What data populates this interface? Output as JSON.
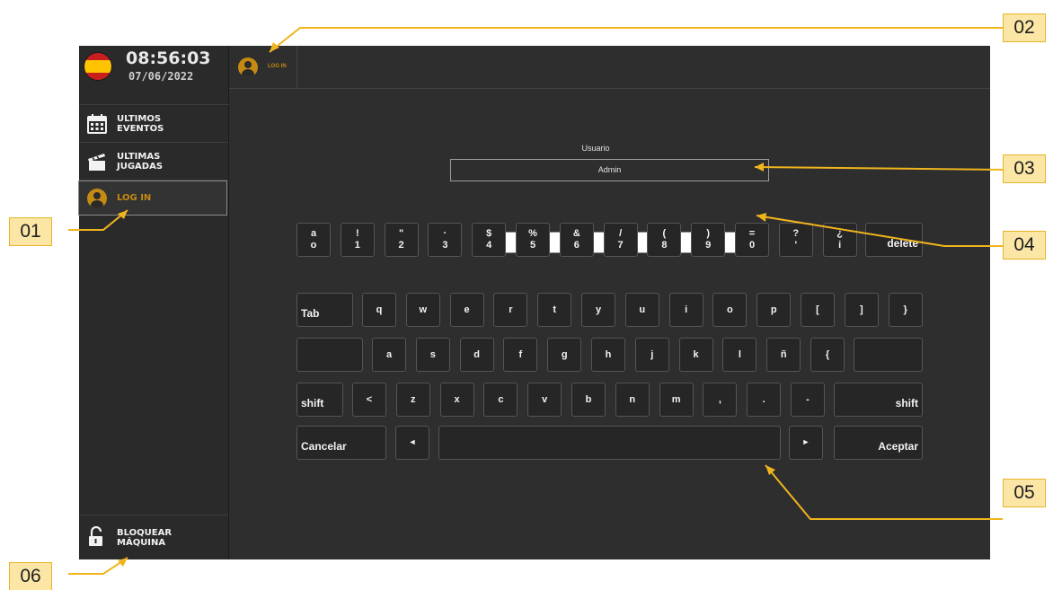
{
  "header": {
    "time": "08:56:03",
    "date": "07/06/2022",
    "flag_icon": "spain-flag-icon"
  },
  "sidebar": {
    "items": [
      {
        "label": "ULTIMOS\nEVENTOS",
        "icon": "calendar-icon",
        "active": false
      },
      {
        "label": "ULTIMAS\nJUGADAS",
        "icon": "clapperboard-icon",
        "active": false
      },
      {
        "label": "LOG IN",
        "icon": "user-avatar-icon",
        "active": true
      }
    ],
    "lock_label": "BLOQUEAR\nMÁQUINA"
  },
  "topbar": {
    "tab_label": "LOG IN"
  },
  "form": {
    "user_label": "Usuario",
    "user_value": "Admin",
    "password_value": ""
  },
  "keyboard": {
    "row1": [
      [
        "a",
        "o"
      ],
      [
        "!",
        "1"
      ],
      [
        "\"",
        "2"
      ],
      [
        "·",
        "3"
      ],
      [
        "$",
        "4"
      ],
      [
        "%",
        "5"
      ],
      [
        "&",
        "6"
      ],
      [
        "/",
        "7"
      ],
      [
        "(",
        "8"
      ],
      [
        ")",
        "9"
      ],
      [
        "=",
        "0"
      ],
      [
        "?",
        "'"
      ],
      [
        "¿",
        "i"
      ]
    ],
    "delete_label": "delete",
    "tab_label": "Tab",
    "row2": [
      "q",
      "w",
      "e",
      "r",
      "t",
      "y",
      "u",
      "i",
      "o",
      "p",
      "[",
      "]",
      "}"
    ],
    "row3": [
      "a",
      "s",
      "d",
      "f",
      "g",
      "h",
      "j",
      "k",
      "l",
      "ñ",
      "{"
    ],
    "shift_label": "shift",
    "row4": [
      "<",
      "z",
      "x",
      "c",
      "v",
      "b",
      "n",
      "m",
      ",",
      ".",
      "-"
    ],
    "cancel_label": "Cancelar",
    "left_arrow": "◄",
    "right_arrow": "►",
    "accept_label": "Aceptar"
  },
  "callouts": [
    "01",
    "02",
    "03",
    "04",
    "05",
    "06"
  ],
  "colors": {
    "accent": "#c48a12",
    "panel": "#2e2e2e",
    "callout_fill": "#fbe6a6",
    "callout_line": "#f0b41e"
  }
}
